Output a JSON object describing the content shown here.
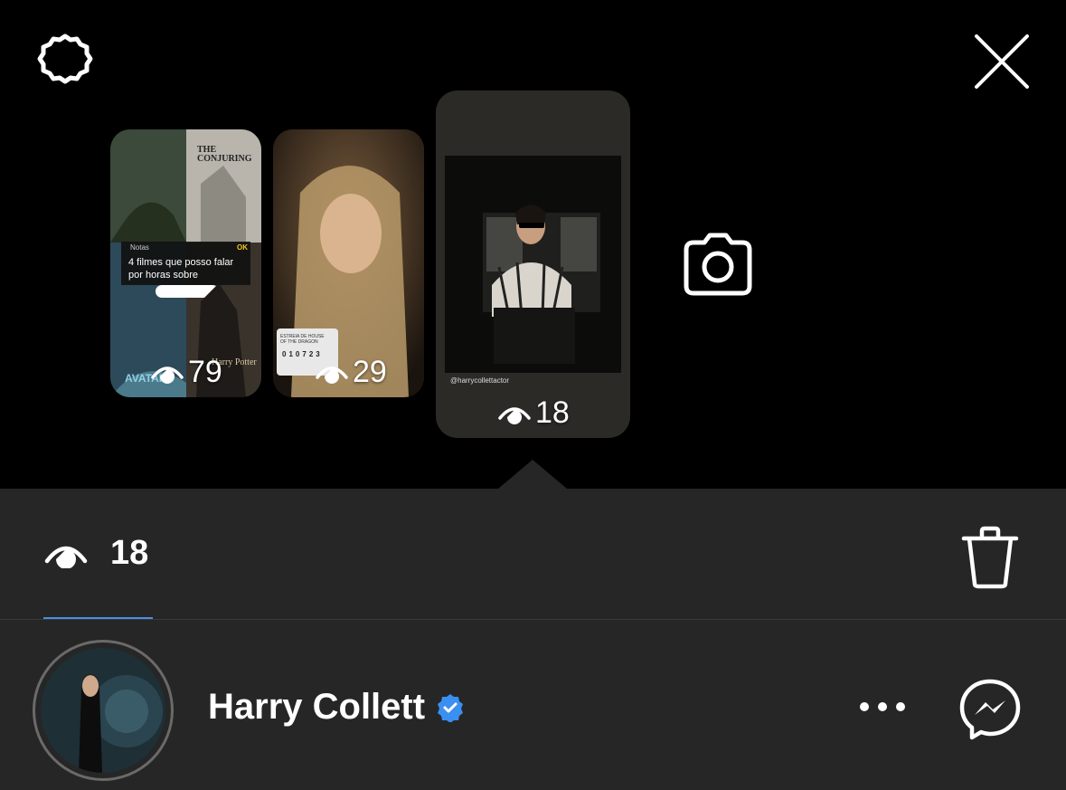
{
  "top": {
    "settings_icon": "gear-icon",
    "close_icon": "close-icon"
  },
  "stories": [
    {
      "views": "79",
      "title_text": "4 filmes que posso falar por horas sobre",
      "header_text": "Notas",
      "ok_text": "OK",
      "poster_labels": [
        "THE CONJURING",
        "AVATAR",
        "Harry Potter"
      ]
    },
    {
      "views": "29",
      "sticker_text": "ESTREIA DE HOUSE OF THE DRAGON",
      "countdown": [
        "0",
        "1",
        "0",
        "7",
        "2",
        "3"
      ]
    },
    {
      "views": "18",
      "mention_text": "@harrycollettactor"
    }
  ],
  "camera_icon": "camera-icon",
  "stats": {
    "view_count": "18",
    "eye_icon": "eye-icon",
    "trash_icon": "trash-icon"
  },
  "viewer": {
    "name": "Harry Collett",
    "verified_icon": "verified-badge-icon",
    "more_icon": "more-icon",
    "messenger_icon": "messenger-icon"
  },
  "colors": {
    "background": "#000000",
    "sheet": "#262626",
    "accent_blue": "#4a90e2",
    "verified_blue": "#3b8ff0"
  }
}
